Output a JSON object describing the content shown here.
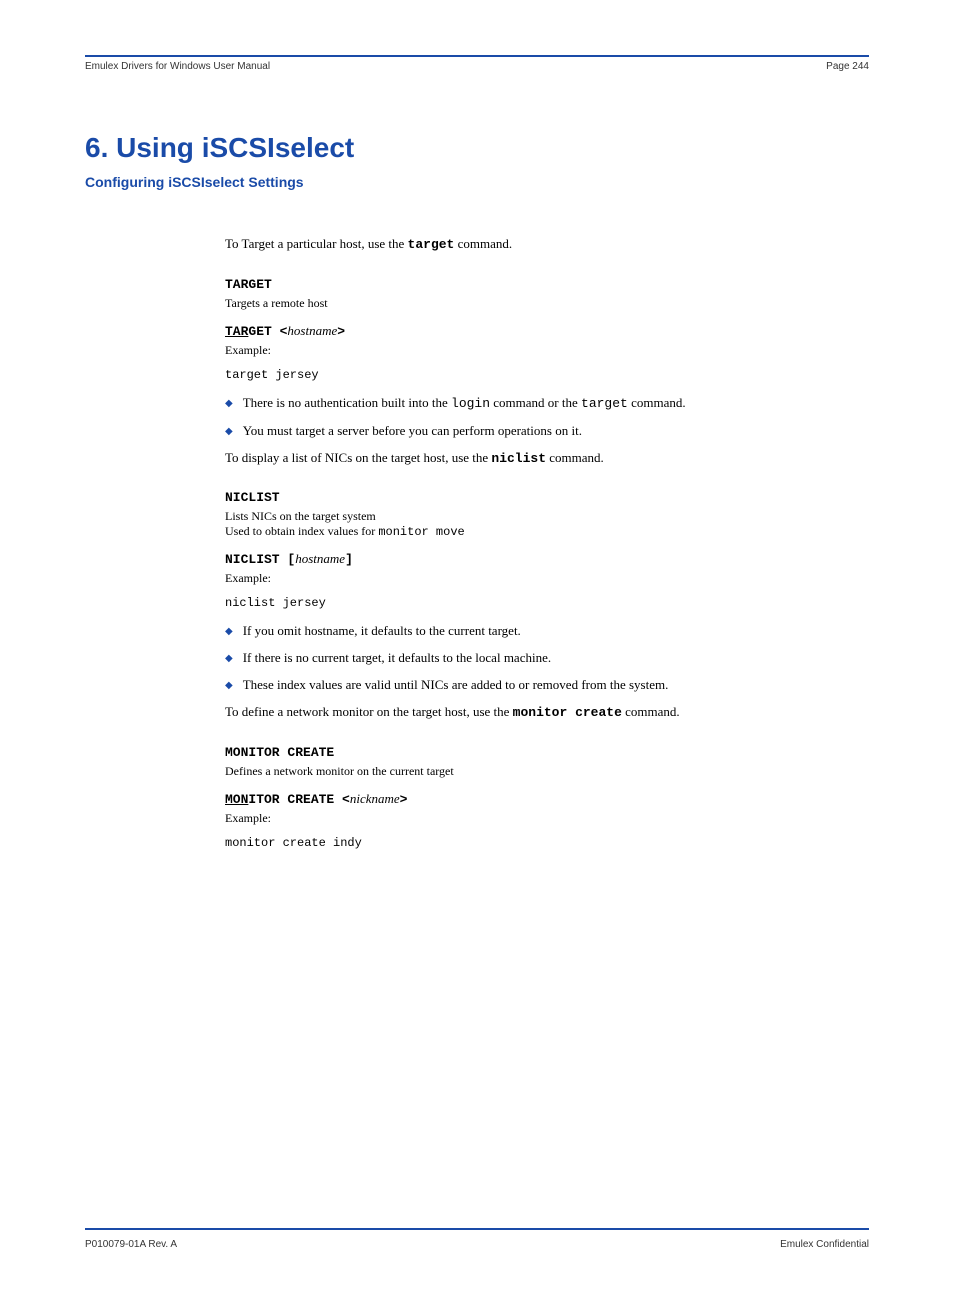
{
  "header": {
    "doc": "Emulex Drivers for Windows User Manual",
    "pagebox": "Page 244"
  },
  "chapter": {
    "title": "6. Using iSCSIselect",
    "subtitle": "Configuring iSCSIselect Settings"
  },
  "intro": {
    "p1_a": "To Target a particular host, use the ",
    "p1_b": "target",
    "p1_c": " command."
  },
  "target": {
    "head": "TARGET",
    "sub": "Targets a remote host",
    "syntax_a": "TAR",
    "syntax_b": "GET <",
    "syntax_c": "hostname",
    "syntax_d": ">",
    "ex_label": "Example:",
    "ex_code": "target jersey",
    "b1_a": "There is no authentication built into the ",
    "b1_b": "login",
    "b1_c": " command or the ",
    "b1_d": "target",
    "b1_e": " command.",
    "b2_a": "You must target a server before you can perform operations on it.",
    "tail_a": "To display a list of NICs on the target host, use the ",
    "tail_b": "niclist",
    "tail_c": " command."
  },
  "niclist": {
    "head": "NICLIST",
    "sub_a": "Lists NICs on the target system",
    "sub_b": "Used to obtain index values for ",
    "sub_c": "monitor move",
    "syntax_a": "NICLIST [",
    "syntax_b": "hostname",
    "syntax_c": "]",
    "ex_label": "Example:",
    "ex_code": "niclist jersey",
    "b1": "If you omit hostname, it defaults to the current target.",
    "b2": "If there is no current target, it defaults to the local machine.",
    "b3": "These index values are valid until NICs are added to or removed from the system.",
    "tail_a": "To define a network monitor on the target host, use the ",
    "tail_b": "monitor create",
    "tail_c": " command."
  },
  "moncreate": {
    "head": "MONITOR CREATE",
    "sub": "Defines a network monitor on the current target",
    "syntax_a": "MON",
    "syntax_b": "ITOR CREATE <",
    "syntax_c": "nickname",
    "syntax_d": ">",
    "ex_label": "Example:",
    "ex_code": "monitor create indy"
  },
  "footer": {
    "guide": "P010079-01A Rev. A",
    "brand": "Emulex Confidential"
  }
}
